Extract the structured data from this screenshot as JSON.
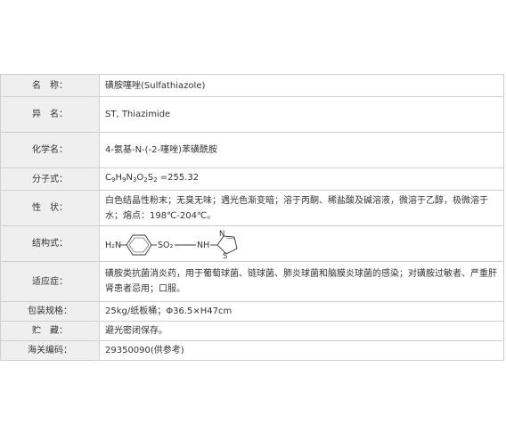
{
  "rows": [
    {
      "label": "名　称：",
      "value": "磺胺噻唑(Sulfathiazole)"
    },
    {
      "label": "异　名：",
      "value": "ST, Thiazimide"
    },
    {
      "label": "化学名：",
      "value": "4-氨基-N-(-2-噻唑)苯磺酰胺"
    },
    {
      "label": "分子式：",
      "formula": [
        "C",
        "9",
        "H",
        "9",
        "N",
        "3",
        "O",
        "2",
        "S",
        "2",
        " =255.32"
      ]
    },
    {
      "label": "性　状：",
      "value": "白色结晶性粉末；无臭无味；遇光色渐变暗；溶于丙酮、稀盐酸及碱溶液，微溶于乙醇，极微溶于水；熔点：198℃-204℃。"
    },
    {
      "label": "结构式：",
      "structure": {
        "left_group": "H₂N",
        "sulfonyl": "SO₂",
        "amine": "NH",
        "ring_n": "N",
        "ring_s": "S"
      }
    },
    {
      "label": "适应症：",
      "value": "磺胺类抗菌消炎药，用于葡萄球菌、链球菌、肺炎球菌和脑膜炎球菌的感染；对磺胺过敏者、严重肝肾患者忌用；口服。"
    },
    {
      "label": "包装规格：",
      "value": "25kg/纸板桶；Φ36.5×H47cm"
    },
    {
      "label": "贮　藏：",
      "value": "避光密闭保存。"
    },
    {
      "label": "海关编码：",
      "value": "29350090(供参考)"
    }
  ]
}
